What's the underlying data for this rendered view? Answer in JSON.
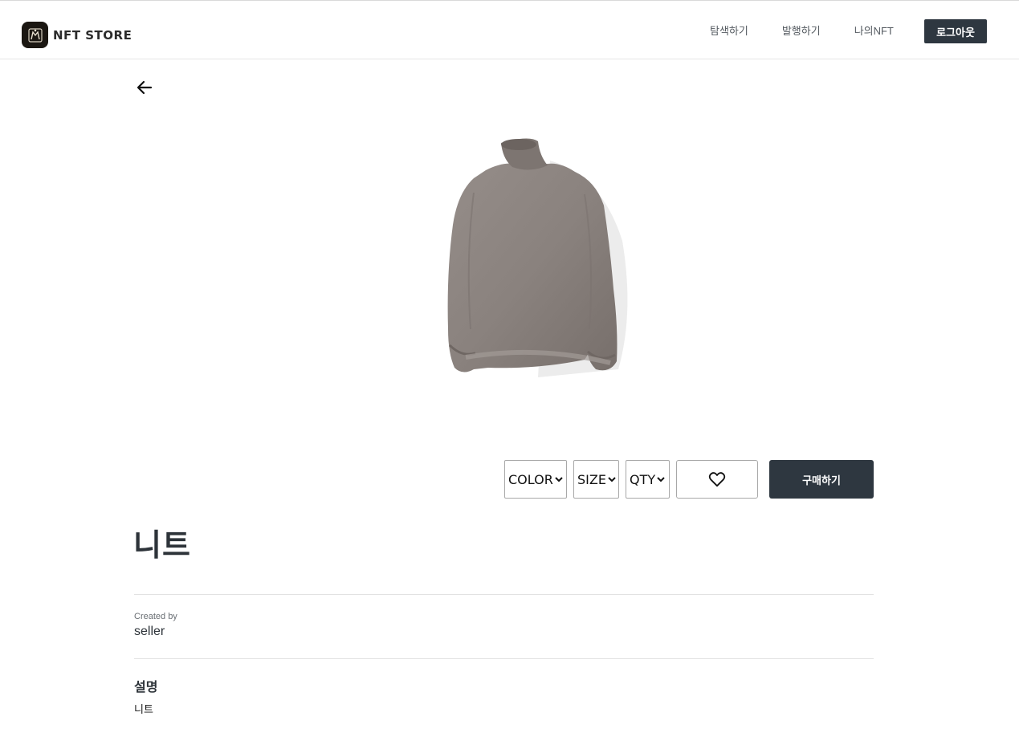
{
  "header": {
    "brand_name": "NFT STORE",
    "nav": [
      {
        "label": "탐색하기"
      },
      {
        "label": "발행하기"
      },
      {
        "label": "나의NFT"
      }
    ],
    "logout_label": "로그아웃"
  },
  "product": {
    "options": {
      "color_label": "COLOR",
      "size_label": "SIZE",
      "qty_label": "QTY"
    },
    "buy_label": "구매하기",
    "title": "니트",
    "created_by_label": "Created by",
    "creator": "seller",
    "description_heading": "설명",
    "description": "니트"
  },
  "colors": {
    "primary_dark": "#2e3740",
    "divider": "#e2e2e2",
    "sweater": "#8a827e"
  },
  "icons": {
    "back": "arrow-left-icon",
    "like": "heart-outline-icon",
    "dropdown": "chevron-down-icon"
  }
}
